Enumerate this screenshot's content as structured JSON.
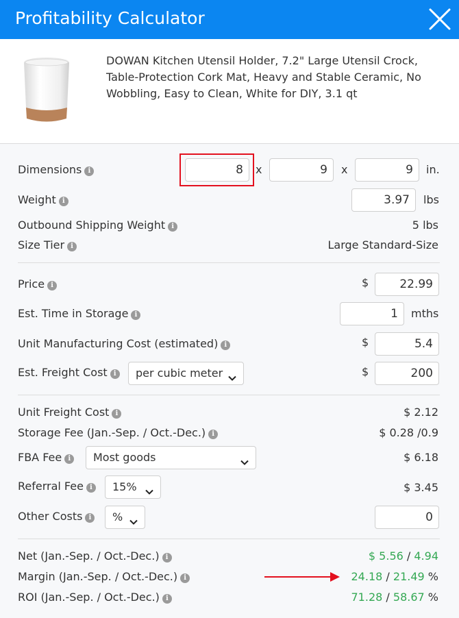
{
  "header": {
    "title": "Profitability Calculator",
    "close_icon": "close-icon"
  },
  "product": {
    "name": "DOWAN Kitchen Utensil Holder, 7.2\" Large Utensil Crock, Table-Protection Cork Mat, Heavy and Stable Ceramic, No Wobbling, Easy to Clean, White for DIY, 3.1 qt",
    "thumbnail_icon": "utensil-crock-image"
  },
  "dimensions": {
    "label": "Dimensions",
    "length": "8",
    "width": "9",
    "height": "9",
    "sep": "x",
    "unit": "in."
  },
  "weight": {
    "label": "Weight",
    "value": "3.97",
    "unit": "lbs"
  },
  "outbound": {
    "label": "Outbound Shipping Weight",
    "value": "5 lbs"
  },
  "size_tier": {
    "label": "Size Tier",
    "value": "Large Standard-Size"
  },
  "price": {
    "label": "Price",
    "currency": "$",
    "value": "22.99"
  },
  "storage_time": {
    "label": "Est. Time in Storage",
    "value": "1",
    "unit": "mths"
  },
  "manufacturing": {
    "label": "Unit Manufacturing Cost (estimated)",
    "currency": "$",
    "value": "5.4"
  },
  "freight": {
    "label": "Est. Freight Cost",
    "mode": "per cubic meter",
    "currency": "$",
    "value": "200"
  },
  "unit_freight": {
    "label": "Unit Freight Cost",
    "value": "$ 2.12"
  },
  "storage_fee": {
    "label": "Storage Fee (Jan.-Sep. / Oct.-Dec.)",
    "value": "$ 0.28 /0.9"
  },
  "fba_fee": {
    "label": "FBA Fee",
    "category": "Most goods",
    "value": "$ 6.18"
  },
  "referral_fee": {
    "label": "Referral Fee",
    "rate": "15%",
    "value": "$ 3.45"
  },
  "other_costs": {
    "label": "Other Costs",
    "unit": "%",
    "value": "0"
  },
  "net": {
    "label": "Net (Jan.-Sep. / Oct.-Dec.)",
    "currency": "$",
    "value1": "5.56",
    "sep": "/",
    "value2": "4.94"
  },
  "margin": {
    "label": "Margin (Jan.-Sep. / Oct.-Dec.)",
    "value1": "24.18",
    "sep": "/",
    "value2": "21.49",
    "unit": "%"
  },
  "roi": {
    "label": "ROI (Jan.-Sep. / Oct.-Dec.)",
    "value1": "71.28",
    "sep": "/",
    "value2": "58.67",
    "unit": "%"
  },
  "colors": {
    "header": "#0b86f1",
    "positive": "#34a853",
    "annotation": "#e3101e"
  }
}
